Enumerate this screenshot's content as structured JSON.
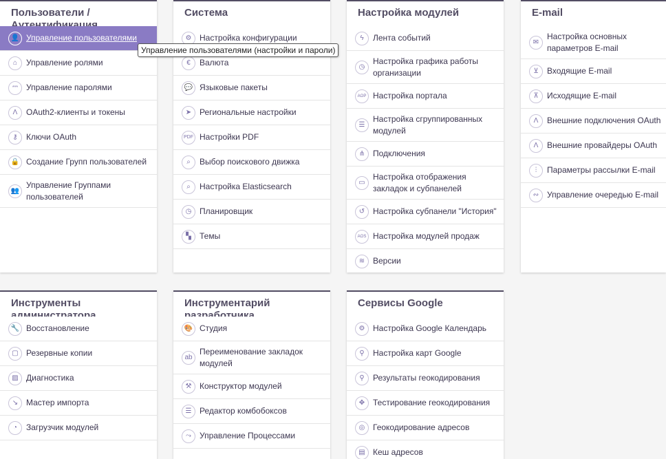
{
  "tooltip": "Управление пользователями (настройки и пароли)",
  "panels": {
    "users": {
      "title": "Пользователи / Аутентификация",
      "items": [
        {
          "label": "Управление пользователями",
          "icon": "user-icon",
          "glyph": "👤"
        },
        {
          "label": "Управление ролями",
          "icon": "laptop-icon",
          "glyph": "⌂"
        },
        {
          "label": "Управление паролями",
          "icon": "password-icon",
          "glyph": "***"
        },
        {
          "label": "OAuth2-клиенты и токены",
          "icon": "oauth-icon",
          "glyph": "Λ"
        },
        {
          "label": "Ключи OAuth",
          "icon": "key-icon",
          "glyph": "⚷"
        },
        {
          "label": "Создание Групп пользователей",
          "icon": "lock-icon",
          "glyph": "🔒"
        },
        {
          "label": "Управление Группами пользователей",
          "icon": "group-icon",
          "glyph": "👥"
        }
      ]
    },
    "system": {
      "title": "Система",
      "items": [
        {
          "label": "Настройка конфигурации",
          "icon": "gear-icon",
          "glyph": "⚙"
        },
        {
          "label": "Валюта",
          "icon": "currency-icon",
          "glyph": "€"
        },
        {
          "label": "Языковые пакеты",
          "icon": "chat-icon",
          "glyph": "💬"
        },
        {
          "label": "Региональные настройки",
          "icon": "navigation-icon",
          "glyph": "➤"
        },
        {
          "label": "Настройки PDF",
          "icon": "pdf-icon",
          "glyph": "PDF"
        },
        {
          "label": "Выбор поискового движка",
          "icon": "search-engine-icon",
          "glyph": "⌕"
        },
        {
          "label": "Настройка Elasticsearch",
          "icon": "elasticsearch-icon",
          "glyph": "⌕"
        },
        {
          "label": "Планировщик",
          "icon": "clock-icon",
          "glyph": "◷"
        },
        {
          "label": "Темы",
          "icon": "themes-icon",
          "glyph": "▚"
        }
      ]
    },
    "modules": {
      "title": "Настройка модулей",
      "items": [
        {
          "label": "Лента событий",
          "icon": "lightning-icon",
          "glyph": "ϟ"
        },
        {
          "label": "Настройка графика работы организации",
          "icon": "schedule-icon",
          "glyph": "◷"
        },
        {
          "label": "Настройка портала",
          "icon": "aop-icon",
          "glyph": "AOP"
        },
        {
          "label": "Настройка сгруппированных модулей",
          "icon": "sliders-icon",
          "glyph": "☰"
        },
        {
          "label": "Подключения",
          "icon": "share-icon",
          "glyph": "⋔"
        },
        {
          "label": "Настройка отображения закладок и субпанелей",
          "icon": "monitor-icon",
          "glyph": "▭"
        },
        {
          "label": "Настройка субпанели \"История\"",
          "icon": "history-icon",
          "glyph": "↺"
        },
        {
          "label": "Настройка модулей продаж",
          "icon": "aos-icon",
          "glyph": "AOS"
        },
        {
          "label": "Версии",
          "icon": "versions-icon",
          "glyph": "≋"
        }
      ]
    },
    "email": {
      "title": "E-mail",
      "items": [
        {
          "label": "Настройка основных параметров E-mail",
          "icon": "envelope-icon",
          "glyph": "✉"
        },
        {
          "label": "Входящие E-mail",
          "icon": "inbox-icon",
          "glyph": "⊻"
        },
        {
          "label": "Исходящие E-mail",
          "icon": "outbox-icon",
          "glyph": "⊼"
        },
        {
          "label": "Внешние подключения OAuth",
          "icon": "oauth-icon",
          "glyph": "Λ"
        },
        {
          "label": "Внешние провайдеры OAuth",
          "icon": "oauth-icon",
          "glyph": "Λ"
        },
        {
          "label": "Параметры рассылки E-mail",
          "icon": "sliders-icon",
          "glyph": "⫶"
        },
        {
          "label": "Управление очередью E-mail",
          "icon": "queue-icon",
          "glyph": "∾"
        }
      ]
    },
    "admin_tools": {
      "title": "Инструменты администратора",
      "items": [
        {
          "label": "Восстановление",
          "icon": "wrench-icon",
          "glyph": "🔧"
        },
        {
          "label": "Резервные копии",
          "icon": "backup-icon",
          "glyph": "▢"
        },
        {
          "label": "Диагностика",
          "icon": "diagnostics-icon",
          "glyph": "▨"
        },
        {
          "label": "Мастер импорта",
          "icon": "import-icon",
          "glyph": "↘"
        },
        {
          "label": "Загрузчик модулей",
          "icon": "loader-icon",
          "glyph": "◔"
        }
      ]
    },
    "dev_tools": {
      "title": "Инструментарий разработчика",
      "items": [
        {
          "label": "Студия",
          "icon": "palette-icon",
          "glyph": "🎨"
        },
        {
          "label": "Переименование закладок модулей",
          "icon": "rename-icon",
          "glyph": "ab"
        },
        {
          "label": "Конструктор модулей",
          "icon": "builder-icon",
          "glyph": "⚒"
        },
        {
          "label": "Редактор комбобоксов",
          "icon": "dropdown-editor-icon",
          "glyph": "☰"
        },
        {
          "label": "Управление Процессами",
          "icon": "workflow-icon",
          "glyph": "⤳"
        }
      ]
    },
    "google": {
      "title": "Сервисы Google",
      "items": [
        {
          "label": "Настройка Google Календарь",
          "icon": "gear-icon",
          "glyph": "⚙"
        },
        {
          "label": "Настройка карт Google",
          "icon": "map-pin-icon",
          "glyph": "⚲"
        },
        {
          "label": "Результаты геокодирования",
          "icon": "map-pin-icon",
          "glyph": "⚲"
        },
        {
          "label": "Тестирование геокодирования",
          "icon": "expand-icon",
          "glyph": "✥"
        },
        {
          "label": "Геокодирование адресов",
          "icon": "target-icon",
          "glyph": "◎"
        },
        {
          "label": "Кеш адресов",
          "icon": "cache-icon",
          "glyph": "▤"
        }
      ]
    }
  }
}
